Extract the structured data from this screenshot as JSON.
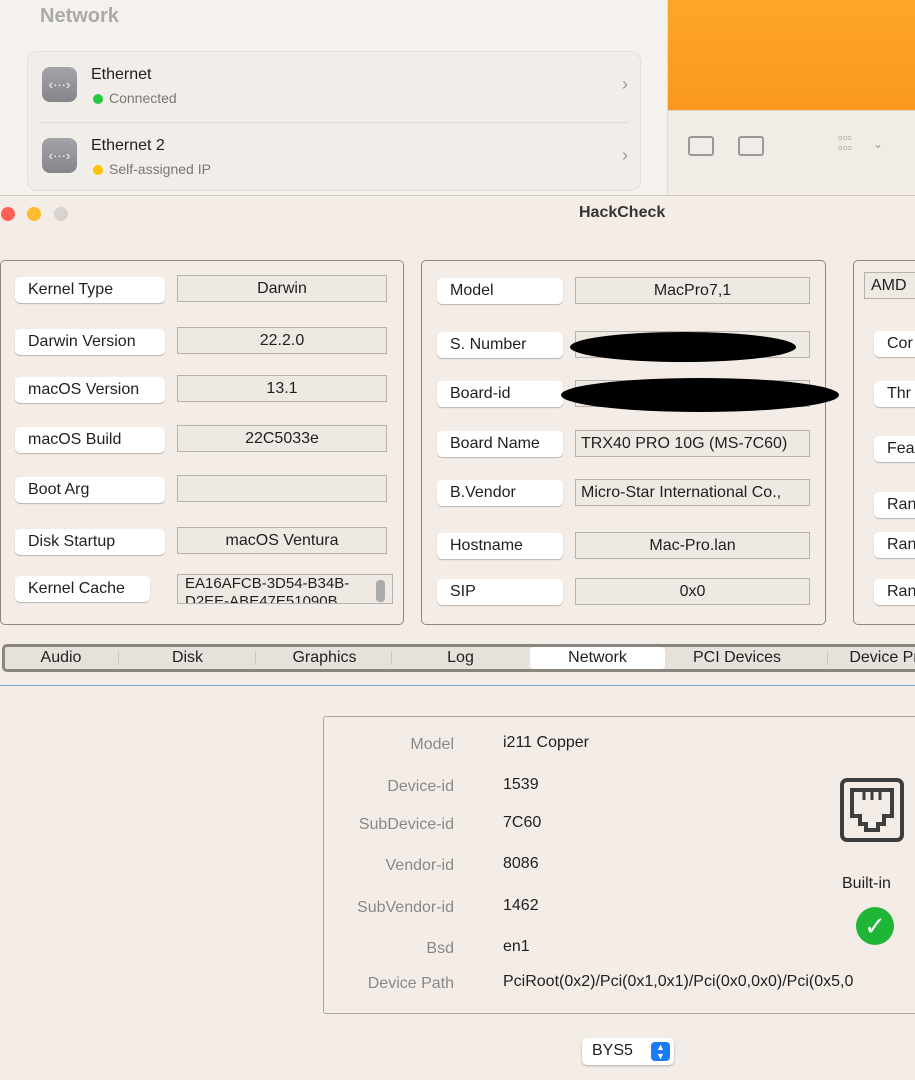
{
  "network_pane": {
    "title": "Network",
    "items": [
      {
        "name": "Ethernet",
        "status": "Connected",
        "status_color": "#28c840"
      },
      {
        "name": "Ethernet 2",
        "status": "Self-assigned IP",
        "status_color": "#ffc107"
      }
    ]
  },
  "window": {
    "title": "HackCheck"
  },
  "system": {
    "rows": [
      {
        "label": "Kernel Type",
        "value": "Darwin"
      },
      {
        "label": "Darwin Version",
        "value": "22.2.0"
      },
      {
        "label": "macOS Version",
        "value": "13.1"
      },
      {
        "label": "macOS Build",
        "value": "22C5033e"
      },
      {
        "label": "Boot Arg",
        "value": ""
      },
      {
        "label": "Disk Startup",
        "value": "macOS Ventura"
      },
      {
        "label": "Kernel Cache",
        "value": "EA16AFCB-3D54-B34B-D2EE-ABE47E51090B"
      }
    ]
  },
  "board": {
    "rows": [
      {
        "label": "Model",
        "value": "MacPro7,1"
      },
      {
        "label": "S. Number",
        "value": ""
      },
      {
        "label": "Board-id",
        "value": ""
      },
      {
        "label": "Board Name",
        "value": "TRX40 PRO 10G (MS-7C60)"
      },
      {
        "label": "B.Vendor",
        "value": "Micro-Star International Co.,"
      },
      {
        "label": "Hostname",
        "value": "Mac-Pro.lan"
      },
      {
        "label": "SIP",
        "value": "0x0"
      }
    ]
  },
  "cpu": {
    "value": "AMD",
    "labels": [
      "Cor",
      "Thr",
      "Fea",
      "Ran",
      "Ran",
      "Ran"
    ]
  },
  "tabs": [
    {
      "label": "Audio"
    },
    {
      "label": "Disk"
    },
    {
      "label": "Graphics"
    },
    {
      "label": "Log"
    },
    {
      "label": "Network",
      "selected": true
    },
    {
      "label": "PCI Devices"
    },
    {
      "label": "Device Pr"
    }
  ],
  "network": {
    "rows": [
      {
        "label": "Model",
        "value": "i211 Copper"
      },
      {
        "label": "Device-id",
        "value": "1539"
      },
      {
        "label": "SubDevice-id",
        "value": "7C60"
      },
      {
        "label": "Vendor-id",
        "value": "8086"
      },
      {
        "label": "SubVendor-id",
        "value": "1462"
      },
      {
        "label": "Bsd",
        "value": "en1"
      },
      {
        "label": "Device Path",
        "value": "PciRoot(0x2)/Pci(0x1,0x1)/Pci(0x0,0x0)/Pci(0x5,0"
      }
    ],
    "builtin_label": "Built-in",
    "interface_select": "BYS5"
  }
}
